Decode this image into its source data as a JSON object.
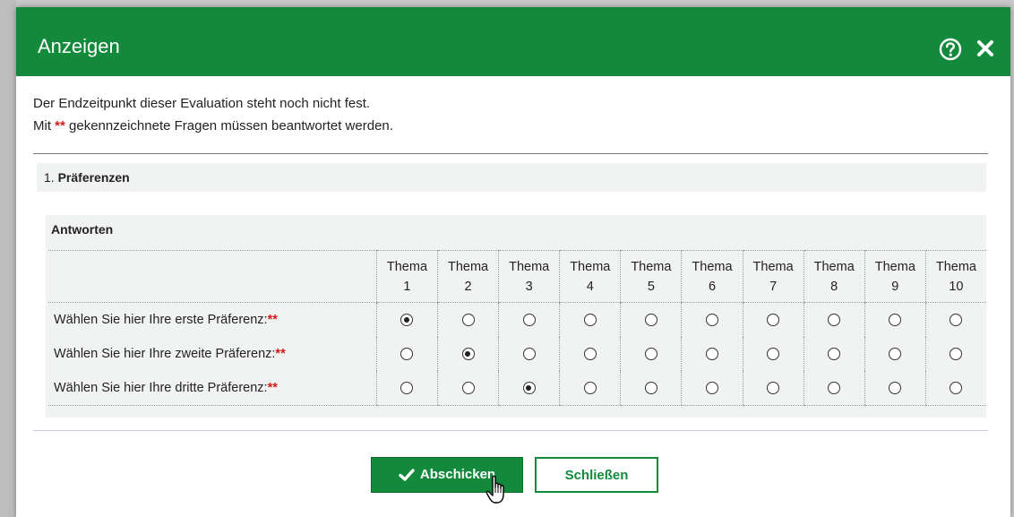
{
  "dialog": {
    "title": "Anzeigen",
    "help_icon": "help-icon",
    "close_icon": "close-icon",
    "accent_color": "#138a3b"
  },
  "intro": {
    "line1": "Der Endzeitpunkt dieser Evaluation steht noch nicht fest.",
    "line2_prefix": "Mit",
    "required_marker": "**",
    "line2_suffix": "gekennzeichnete Fragen müssen beantwortet werden."
  },
  "section": {
    "number": "1.",
    "name": "Präferenzen"
  },
  "answers": {
    "label": "Antworten",
    "columns": [
      {
        "top": "Thema",
        "bottom": "1"
      },
      {
        "top": "Thema",
        "bottom": "2"
      },
      {
        "top": "Thema",
        "bottom": "3"
      },
      {
        "top": "Thema",
        "bottom": "4"
      },
      {
        "top": "Thema",
        "bottom": "5"
      },
      {
        "top": "Thema",
        "bottom": "6"
      },
      {
        "top": "Thema",
        "bottom": "7"
      },
      {
        "top": "Thema",
        "bottom": "8"
      },
      {
        "top": "Thema",
        "bottom": "9"
      },
      {
        "top": "Thema",
        "bottom": "10"
      }
    ],
    "rows": [
      {
        "question": "Wählen Sie hier Ihre erste Präferenz:",
        "required": "**",
        "selected": 1
      },
      {
        "question": "Wählen Sie hier Ihre zweite Präferenz:",
        "required": "**",
        "selected": 2
      },
      {
        "question": "Wählen Sie hier Ihre dritte Präferenz:",
        "required": "**",
        "selected": 3
      }
    ]
  },
  "buttons": {
    "submit_label": "Abschicken",
    "submit_icon": "check-icon",
    "close_label": "Schließen"
  }
}
